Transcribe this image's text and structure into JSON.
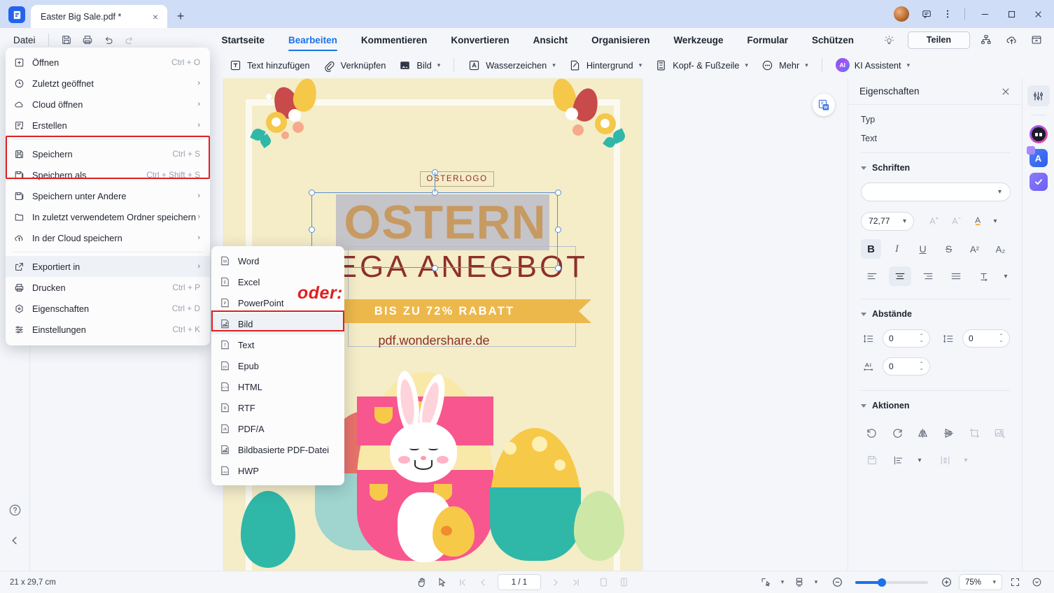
{
  "window": {
    "app_logo": "wondershare-pdfelement-logo",
    "tab_title": "Easter Big Sale.pdf *",
    "new_tab": "+",
    "close_tab": "×",
    "minimize": "—",
    "maximize": "□",
    "close": "✕"
  },
  "menubar": {
    "file_label": "Datei",
    "quick_actions": [
      {
        "name": "save-icon",
        "enabled": true
      },
      {
        "name": "print-icon",
        "enabled": true
      },
      {
        "name": "undo-icon",
        "enabled": true
      },
      {
        "name": "redo-icon",
        "enabled": false
      }
    ],
    "tabs": [
      {
        "label": "Startseite",
        "active": false
      },
      {
        "label": "Bearbeiten",
        "active": true
      },
      {
        "label": "Kommentieren",
        "active": false
      },
      {
        "label": "Konvertieren",
        "active": false
      },
      {
        "label": "Ansicht",
        "active": false
      },
      {
        "label": "Organisieren",
        "active": false
      },
      {
        "label": "Werkzeuge",
        "active": false
      },
      {
        "label": "Formular",
        "active": false
      },
      {
        "label": "Schützen",
        "active": false
      }
    ],
    "share_label": "Teilen"
  },
  "toolbar": {
    "items": [
      {
        "label": "Text hinzufügen",
        "icon": "text-box-icon",
        "caret": false
      },
      {
        "label": "Verknüpfen",
        "icon": "link-paperclip-icon",
        "caret": false
      },
      {
        "label": "Bild",
        "icon": "image-icon",
        "caret": true
      },
      {
        "label": "Wasserzeichen",
        "icon": "watermark-icon",
        "caret": true
      },
      {
        "label": "Hintergrund",
        "icon": "background-icon",
        "caret": true
      },
      {
        "label": "Kopf- & Fußzeile",
        "icon": "header-footer-icon",
        "caret": true
      },
      {
        "label": "Mehr",
        "icon": "more-dots-icon",
        "caret": true
      },
      {
        "label": "KI Assistent",
        "icon": "ai-badge-icon",
        "caret": true
      }
    ],
    "ai_badge_text": "AI"
  },
  "file_menu": {
    "items": [
      {
        "label": "Öffnen",
        "shortcut": "Ctrl + O",
        "arrow": false,
        "icon": "plus-box-icon"
      },
      {
        "label": "Zuletzt geöffnet",
        "shortcut": "",
        "arrow": true,
        "icon": "clock-icon"
      },
      {
        "label": "Cloud öffnen",
        "shortcut": "",
        "arrow": true,
        "icon": "cloud-icon"
      },
      {
        "label": "Erstellen",
        "shortcut": "",
        "arrow": true,
        "icon": "create-doc-icon"
      },
      {
        "label": "Speichern",
        "shortcut": "Ctrl + S",
        "arrow": false,
        "icon": "floppy-icon"
      },
      {
        "label": "Speichern als",
        "shortcut": "Ctrl + Shift + S",
        "arrow": false,
        "icon": "floppy-copy-icon"
      },
      {
        "label": "Speichern unter Andere",
        "shortcut": "",
        "arrow": true,
        "icon": "floppy-copy-icon"
      },
      {
        "label": "In zuletzt verwendetem Ordner speichern",
        "shortcut": "",
        "arrow": true,
        "icon": "folder-icon"
      },
      {
        "label": "In der Cloud speichern",
        "shortcut": "",
        "arrow": true,
        "icon": "cloud-upload-icon"
      },
      {
        "label": "Exportiert in",
        "shortcut": "",
        "arrow": true,
        "icon": "export-icon"
      },
      {
        "label": "Drucken",
        "shortcut": "Ctrl + P",
        "arrow": false,
        "icon": "printer-icon"
      },
      {
        "label": "Eigenschaften",
        "shortcut": "Ctrl + D",
        "arrow": false,
        "icon": "properties-icon"
      },
      {
        "label": "Einstellungen",
        "shortcut": "Ctrl + K",
        "arrow": false,
        "icon": "settings-sliders-icon"
      }
    ],
    "highlight_color": "#e02020"
  },
  "export_submenu": {
    "items": [
      {
        "label": "Word",
        "icon": "word-file-icon"
      },
      {
        "label": "Excel",
        "icon": "excel-file-icon"
      },
      {
        "label": "PowerPoint",
        "icon": "powerpoint-file-icon"
      },
      {
        "label": "Bild",
        "icon": "image-file-icon"
      },
      {
        "label": "Text",
        "icon": "text-file-icon"
      },
      {
        "label": "Epub",
        "icon": "epub-file-icon"
      },
      {
        "label": "HTML",
        "icon": "html-file-icon"
      },
      {
        "label": "RTF",
        "icon": "rtf-file-icon"
      },
      {
        "label": "PDF/A",
        "icon": "pdfa-file-icon"
      },
      {
        "label": "Bildbasierte PDF-Datei",
        "icon": "image-pdf-file-icon"
      },
      {
        "label": "HWP",
        "icon": "hwp-file-icon"
      }
    ],
    "selected": "Bild"
  },
  "annotation": {
    "oder_label": "oder:",
    "color": "#e02020"
  },
  "document": {
    "logo_text": "OSTERLOGO",
    "headline": "OSTERN",
    "subheadline": "MEGA ANEGBOT",
    "banner_text": "BIS ZU 72% RABATT",
    "url": "pdf.wondershare.de",
    "background_color": "#f4edc8",
    "headline_color": "#c79a62",
    "accent_color": "#8d2f2a",
    "banner_color": "#edb84b",
    "badge": "W"
  },
  "properties_panel": {
    "title": "Eigenschaften",
    "type_label": "Typ",
    "type_value": "Text",
    "fonts_section": "Schriften",
    "font_family_value": "",
    "font_size_value": "72,77",
    "format_buttons": [
      {
        "name": "bold-button",
        "glyph": "B",
        "active": true
      },
      {
        "name": "italic-button",
        "glyph": "I",
        "active": false
      },
      {
        "name": "underline-button",
        "glyph": "U",
        "active": false
      },
      {
        "name": "strikethrough-button",
        "glyph": "S",
        "active": false
      },
      {
        "name": "superscript-button",
        "glyph": "A²",
        "active": false
      },
      {
        "name": "subscript-button",
        "glyph": "A₂",
        "active": false
      }
    ],
    "align_buttons": [
      {
        "name": "align-left-button",
        "active": false
      },
      {
        "name": "align-center-button",
        "active": true
      },
      {
        "name": "align-right-button",
        "active": false
      },
      {
        "name": "align-justify-button",
        "active": false
      },
      {
        "name": "text-direction-button",
        "active": false
      }
    ],
    "spacing_section": "Abstände",
    "line_spacing_value": "0",
    "paragraph_spacing_value": "0",
    "char_spacing_value": "0",
    "actions_section": "Aktionen",
    "actions": [
      {
        "name": "rotate-left-icon",
        "enabled": true
      },
      {
        "name": "rotate-right-icon",
        "enabled": true
      },
      {
        "name": "flip-horizontal-icon",
        "enabled": true
      },
      {
        "name": "flip-vertical-icon",
        "enabled": true
      },
      {
        "name": "crop-icon",
        "enabled": false
      },
      {
        "name": "replace-image-icon",
        "enabled": false
      },
      {
        "name": "save-as-icon",
        "enabled": false
      },
      {
        "name": "align-objects-icon",
        "enabled": true
      },
      {
        "name": "distribute-icon",
        "enabled": false
      }
    ]
  },
  "right_rail": {
    "items": [
      {
        "name": "properties-panel-icon",
        "selected": true
      },
      {
        "name": "ai-robot-icon",
        "selected": false
      },
      {
        "name": "translate-app-icon",
        "selected": false
      },
      {
        "name": "checkmark-app-icon",
        "selected": false
      }
    ]
  },
  "left_rail": {
    "help_icon": "help-question-icon",
    "collapse_icon": "chevron-left-icon"
  },
  "statusbar": {
    "page_dimensions": "21 x 29,7 cm",
    "page_indicator": "1 / 1",
    "zoom_level": "75%",
    "tools": [
      {
        "name": "hand-tool-icon",
        "enabled": true
      },
      {
        "name": "select-tool-icon",
        "enabled": true
      },
      {
        "name": "first-page-icon",
        "enabled": false
      },
      {
        "name": "prev-page-icon",
        "enabled": false
      },
      {
        "name": "next-page-icon",
        "enabled": false
      },
      {
        "name": "last-page-icon",
        "enabled": false
      },
      {
        "name": "single-page-view-icon",
        "enabled": true
      },
      {
        "name": "facing-page-view-icon",
        "enabled": true
      }
    ],
    "right_tools": [
      {
        "name": "scroll-mode-icon"
      },
      {
        "name": "page-layout-icon"
      },
      {
        "name": "zoom-out-icon"
      },
      {
        "name": "zoom-in-icon"
      },
      {
        "name": "fullscreen-icon"
      },
      {
        "name": "more-options-icon"
      }
    ]
  }
}
